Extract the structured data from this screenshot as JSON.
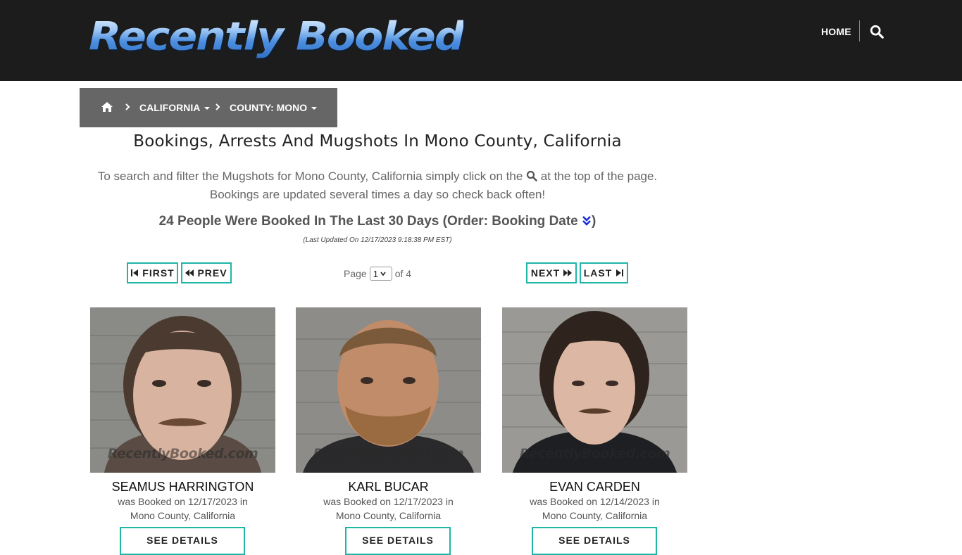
{
  "header": {
    "logo_text": "Recently Booked",
    "nav_home": "HOME",
    "search_icon": "search-icon"
  },
  "breadcrumb": {
    "home_icon": "home-icon",
    "state": "CALIFORNIA",
    "county": "COUNTY: MONO"
  },
  "page": {
    "title": "Bookings, Arrests And Mugshots In Mono County, California",
    "intro_part1": "To search and filter the Mugshots for Mono County, California simply click on the",
    "intro_part2": "at the top of the page.",
    "intro_line2": "Bookings are updated several times a day so check back often!",
    "count_text": "24 People Were Booked In The Last 30 Days (Order: Booking Date",
    "count_close": ")",
    "updated": "(Last Updated On 12/17/2023 9:18:38 PM EST)"
  },
  "pagination": {
    "first": "FIRST",
    "prev": "PREV",
    "next": "NEXT",
    "last": "LAST",
    "page_label": "Page",
    "current_page": "1",
    "of_label": "of 4"
  },
  "watermark": "RecentlyBooked.com",
  "people": [
    {
      "name": "SEAMUS HARRINGTON",
      "line1": "was Booked on 12/17/2023 in",
      "line2": "Mono County, California",
      "button": "SEE DETAILS"
    },
    {
      "name": "KARL BUCAR",
      "line1": "was Booked on 12/17/2023 in",
      "line2": "Mono County, California",
      "button": "SEE DETAILS"
    },
    {
      "name": "EVAN CARDEN",
      "line1": "was Booked on 12/14/2023 in",
      "line2": "Mono County, California",
      "button": "SEE DETAILS"
    }
  ],
  "colors": {
    "header_bg": "#1c1c1c",
    "breadcrumb_bg": "#666666",
    "accent_teal": "#1fb5a9",
    "sort_icon": "#1a2fd6"
  }
}
